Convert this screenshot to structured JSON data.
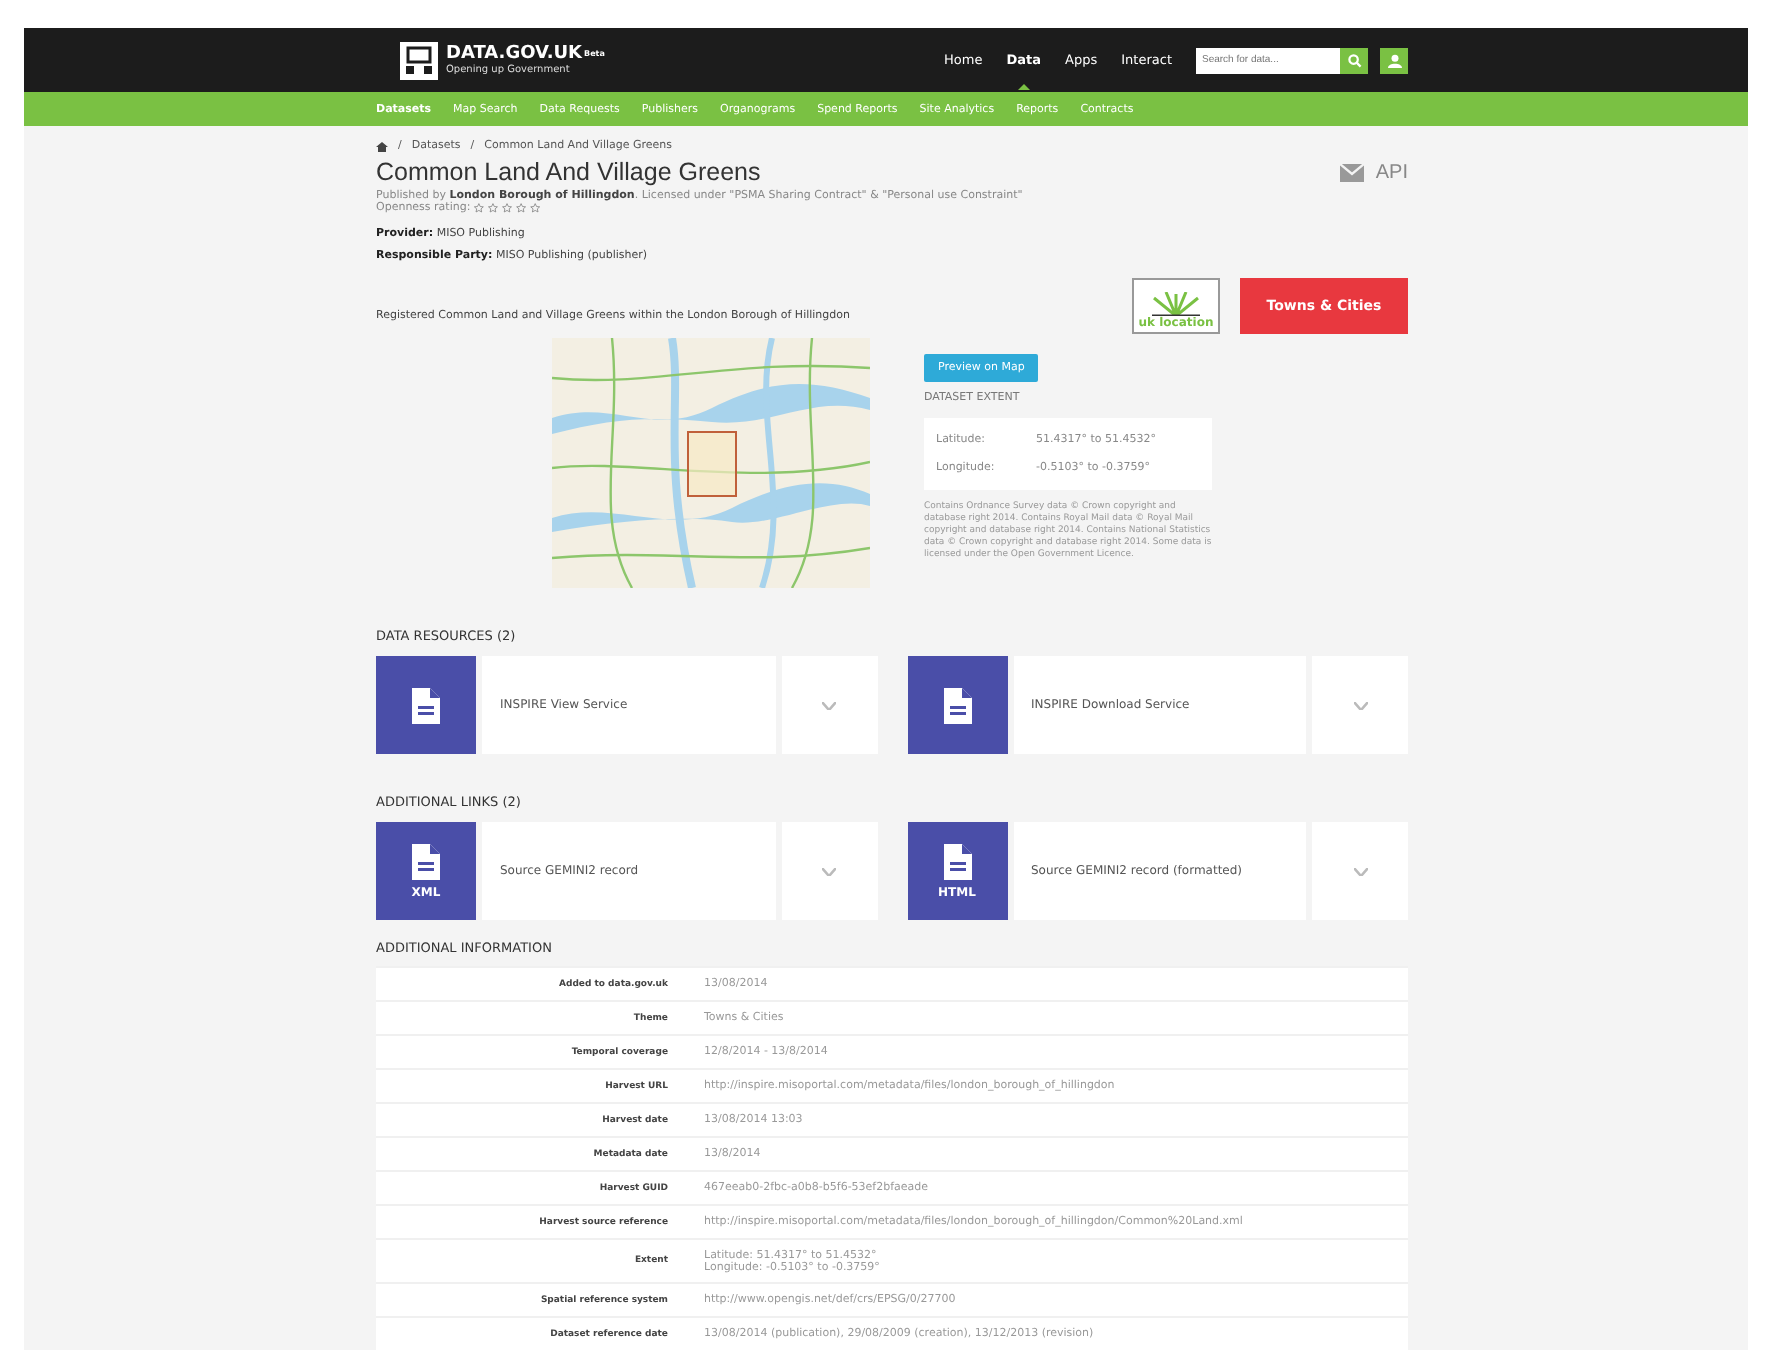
{
  "header": {
    "logo_title": "DATA.GOV.UK",
    "logo_badge": "Beta",
    "logo_subtitle": "Opening up Government",
    "nav": [
      {
        "label": "Home",
        "selected": false
      },
      {
        "label": "Data",
        "selected": true
      },
      {
        "label": "Apps",
        "selected": false
      },
      {
        "label": "Interact",
        "selected": false
      }
    ],
    "search": {
      "placeholder": "Search for data..."
    }
  },
  "subnav": [
    {
      "label": "Datasets",
      "selected": true
    },
    {
      "label": "Map Search",
      "selected": false
    },
    {
      "label": "Data Requests",
      "selected": false
    },
    {
      "label": "Publishers",
      "selected": false
    },
    {
      "label": "Organograms",
      "selected": false
    },
    {
      "label": "Spend Reports",
      "selected": false
    },
    {
      "label": "Site Analytics",
      "selected": false
    },
    {
      "label": "Reports",
      "selected": false
    },
    {
      "label": "Contracts",
      "selected": false
    }
  ],
  "breadcrumb": [
    "Datasets",
    "Common Land And Village Greens"
  ],
  "breadcrumb_separator": "/",
  "title": "Common Land And Village Greens",
  "api_label": "API",
  "published_line": "Published by **London Borough of Hillingdon**.  Licensed under \"PSMA Sharing Contract\" & \"Personal use Constraint\"",
  "openness": {
    "label": "Openness rating:",
    "stars": 0
  },
  "provider": "**Provider:** MISO Publishing",
  "responsible": "**Responsible Party:** MISO Publishing (publisher)",
  "description": "Registered Common Land and Village Greens within the London Borough of Hillingdon",
  "location_logo": "uk location",
  "theme_button": "Towns & Cities",
  "preview_button": "Preview on Map",
  "extent_heading": "DATASET EXTENT",
  "extent": [
    {
      "label": "Latitude:",
      "value": "51.4317° to 51.4532°"
    },
    {
      "label": "Longitude:",
      "value": "-0.5103° to -0.3759°"
    }
  ],
  "map_notice": "Contains Ordnance Survey data © Crown copyright and database right 2014. Contains Royal Mail data © Royal Mail copyright and database right 2014. Contains National Statistics data © Crown copyright and database right 2014. Some data is licensed under the Open Government Licence.",
  "resources_heading": "DATA RESOURCES (2)",
  "resources": [
    {
      "name": "INSPIRE View Service"
    },
    {
      "name": "INSPIRE Download Service"
    }
  ],
  "links_heading": "ADDITIONAL LINKS (2)",
  "links": [
    {
      "name": "Source GEMINI2 record",
      "format": "XML"
    },
    {
      "name": "Source GEMINI2 record (formatted)",
      "format": "HTML"
    }
  ],
  "info_heading": "ADDITIONAL INFORMATION",
  "info": [
    {
      "label": "Added to data.gov.uk",
      "value": [
        "13/08/2014"
      ]
    },
    {
      "label": "Theme",
      "value": [
        "Towns & Cities"
      ]
    },
    {
      "label": "Temporal coverage",
      "value": [
        "12/8/2014 - 13/8/2014"
      ]
    },
    {
      "label": "Harvest URL",
      "value": [
        "http://inspire.misoportal.com/metadata/files/london_borough_of_hillingdon"
      ]
    },
    {
      "label": "Harvest date",
      "value": [
        "13/08/2014 13:03"
      ]
    },
    {
      "label": "Metadata date",
      "value": [
        "13/8/2014"
      ]
    },
    {
      "label": "Harvest GUID",
      "value": [
        "467eeab0-2fbc-a0b8-b5f6-53ef2bfaeade"
      ]
    },
    {
      "label": "Harvest source reference",
      "value": [
        "http://inspire.misoportal.com/metadata/files/london_borough_of_hillingdon/Common%20Land.xml"
      ]
    },
    {
      "label": "Extent",
      "value": [
        "Latitude: 51.4317° to 51.4532°",
        "Longitude: -0.5103° to -0.3759°"
      ]
    },
    {
      "label": "Spatial reference system",
      "value": [
        "http://www.opengis.net/def/crs/EPSG/0/27700"
      ]
    },
    {
      "label": "Dataset reference date",
      "value": [
        "13/08/2014 (publication), 29/08/2009 (creation), 13/12/2013 (revision)"
      ]
    }
  ]
}
